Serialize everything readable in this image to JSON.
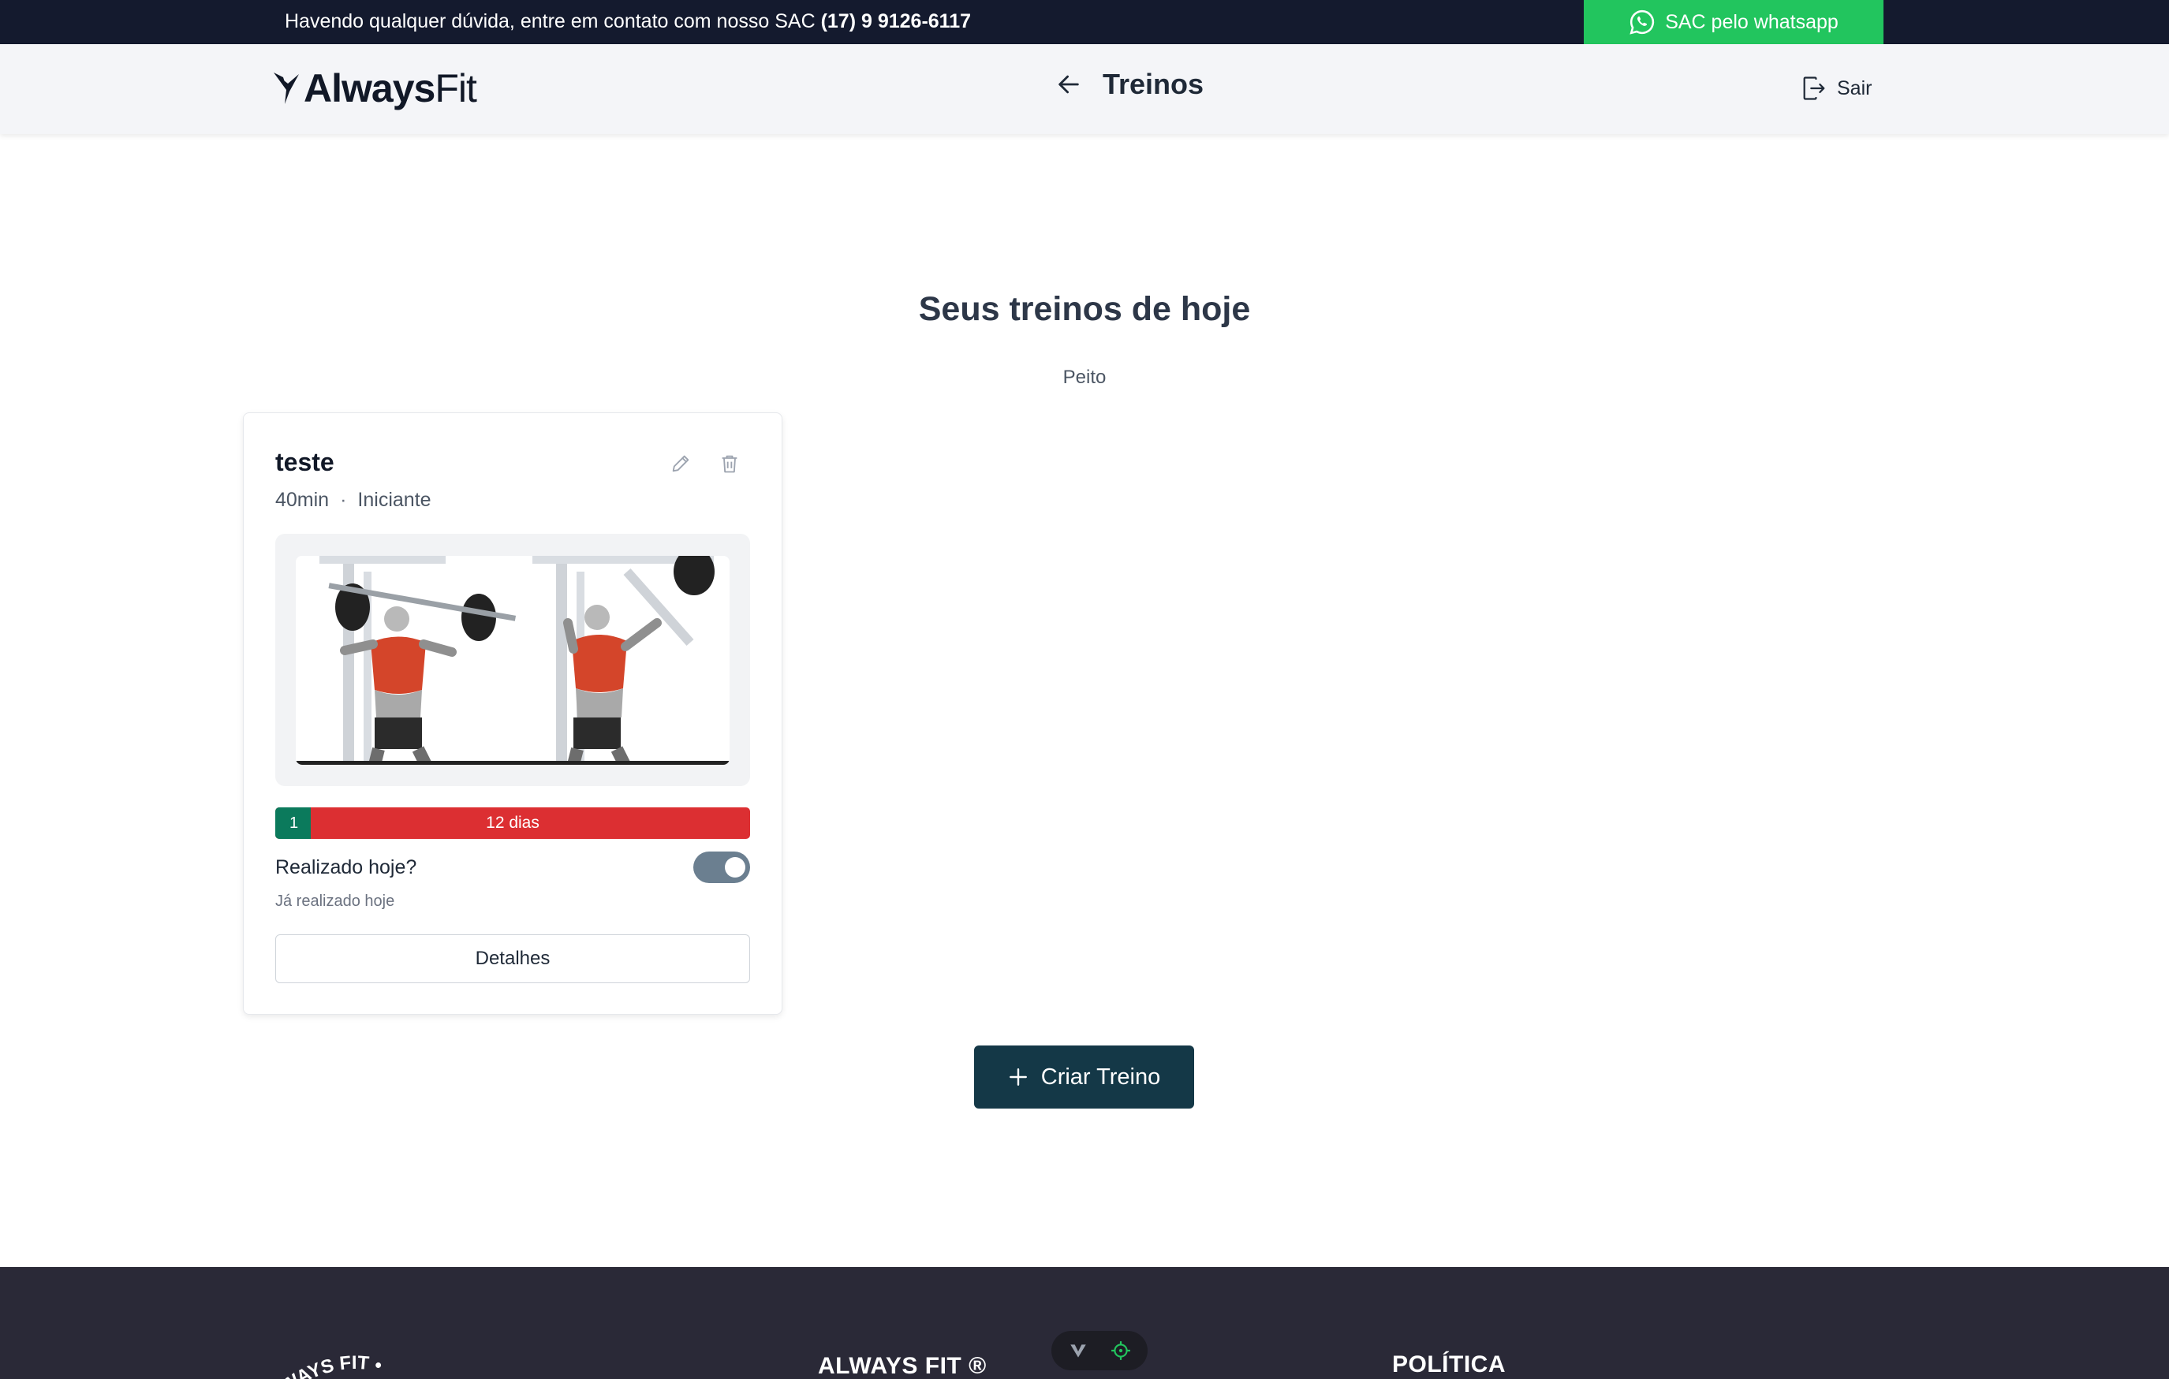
{
  "topbar": {
    "message": "Havendo qualquer dúvida, entre em contato com nosso SAC",
    "phone": "(17) 9 9126-6117",
    "whatsapp_label": "SAC pelo whatsapp",
    "bg_color": "#141a2e",
    "whatsapp_color": "#22c55e"
  },
  "header": {
    "logo_bold": "Always",
    "logo_light": "Fit",
    "title": "Treinos",
    "logout_label": "Sair"
  },
  "main": {
    "title": "Seus treinos de hoje",
    "subtitle": "Peito"
  },
  "workout": {
    "name": "teste",
    "duration": "40min",
    "separator": "·",
    "level": "Iniciante",
    "image_icon": "chest-fly-exercise-illustration",
    "progress": {
      "completed_label": "1",
      "remaining_label": "12 dias",
      "completed_fraction": 0.075,
      "completed_color": "#0b7a5c",
      "remaining_color": "#dc2f32"
    },
    "done_question": "Realizado hoje?",
    "done_toggle_on": true,
    "done_note": "Já realizado hoje",
    "details_label": "Detalhes"
  },
  "actions": {
    "create_label": "Criar Treino",
    "create_color": "#143847"
  },
  "footer": {
    "badge_text": "WAYS FIT •",
    "col1_title": "ALWAYS FIT ®",
    "col2_title": "POLÍTICA",
    "bg_color": "#2a2937"
  }
}
